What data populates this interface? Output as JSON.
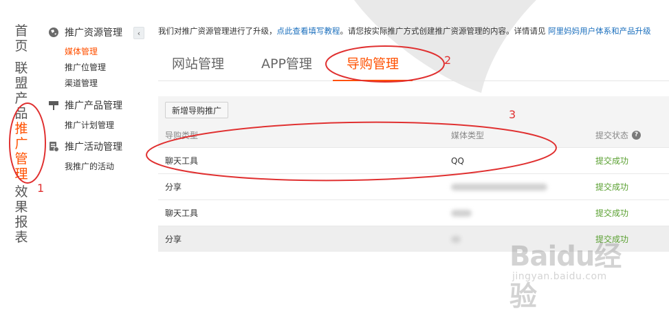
{
  "left_nav": {
    "items": [
      {
        "label": "首页",
        "active": false
      },
      {
        "label": "联盟产品",
        "active": false
      },
      {
        "label": "推广管理",
        "active": true
      },
      {
        "label": "效果报表",
        "active": false
      }
    ]
  },
  "sidebar": {
    "groups": [
      {
        "title": "推广资源管理",
        "icon": "globe-icon",
        "items": [
          "媒体管理",
          "推广位管理",
          "渠道管理"
        ]
      },
      {
        "title": "推广产品管理",
        "icon": "pin-icon",
        "items": [
          "推广计划管理"
        ]
      },
      {
        "title": "推广活动管理",
        "icon": "activity-icon",
        "items": [
          "我推广的活动"
        ]
      }
    ],
    "active_item": "媒体管理",
    "collapse_icon": "chevron-left-icon"
  },
  "notice": {
    "prefix": "我们对推广资源管理进行了升级，",
    "link1": "点此查看填写教程",
    "middle": "。请您按实际推广方式创建推广资源管理的内容。详情请见",
    "link2": "阿里妈妈用户体系和产品升级"
  },
  "tabs": [
    {
      "label": "网站管理",
      "active": false
    },
    {
      "label": "APP管理",
      "active": false
    },
    {
      "label": "导购管理",
      "active": true
    }
  ],
  "toolbar": {
    "add_label": "新增导购推广"
  },
  "table": {
    "headers": [
      "导购类型",
      "媒体类型",
      "提交状态"
    ],
    "help_icon": "question-circle-icon",
    "rows": [
      {
        "type": "聊天工具",
        "media": "QQ",
        "status": "提交成功"
      },
      {
        "type": "分享",
        "media": "",
        "status": "提交成功"
      },
      {
        "type": "聊天工具",
        "media": "",
        "status": "提交成功"
      },
      {
        "type": "分享",
        "media": "",
        "status": "提交成功"
      }
    ]
  },
  "annotations": [
    "1",
    "2",
    "3"
  ],
  "colors": {
    "accent": "#ff5000",
    "link": "#1b6fbd",
    "success": "#5aa031",
    "annotation": "#e03030"
  },
  "watermark": {
    "brand": "Baidu经验",
    "url": "jingyan.baidu.com"
  }
}
